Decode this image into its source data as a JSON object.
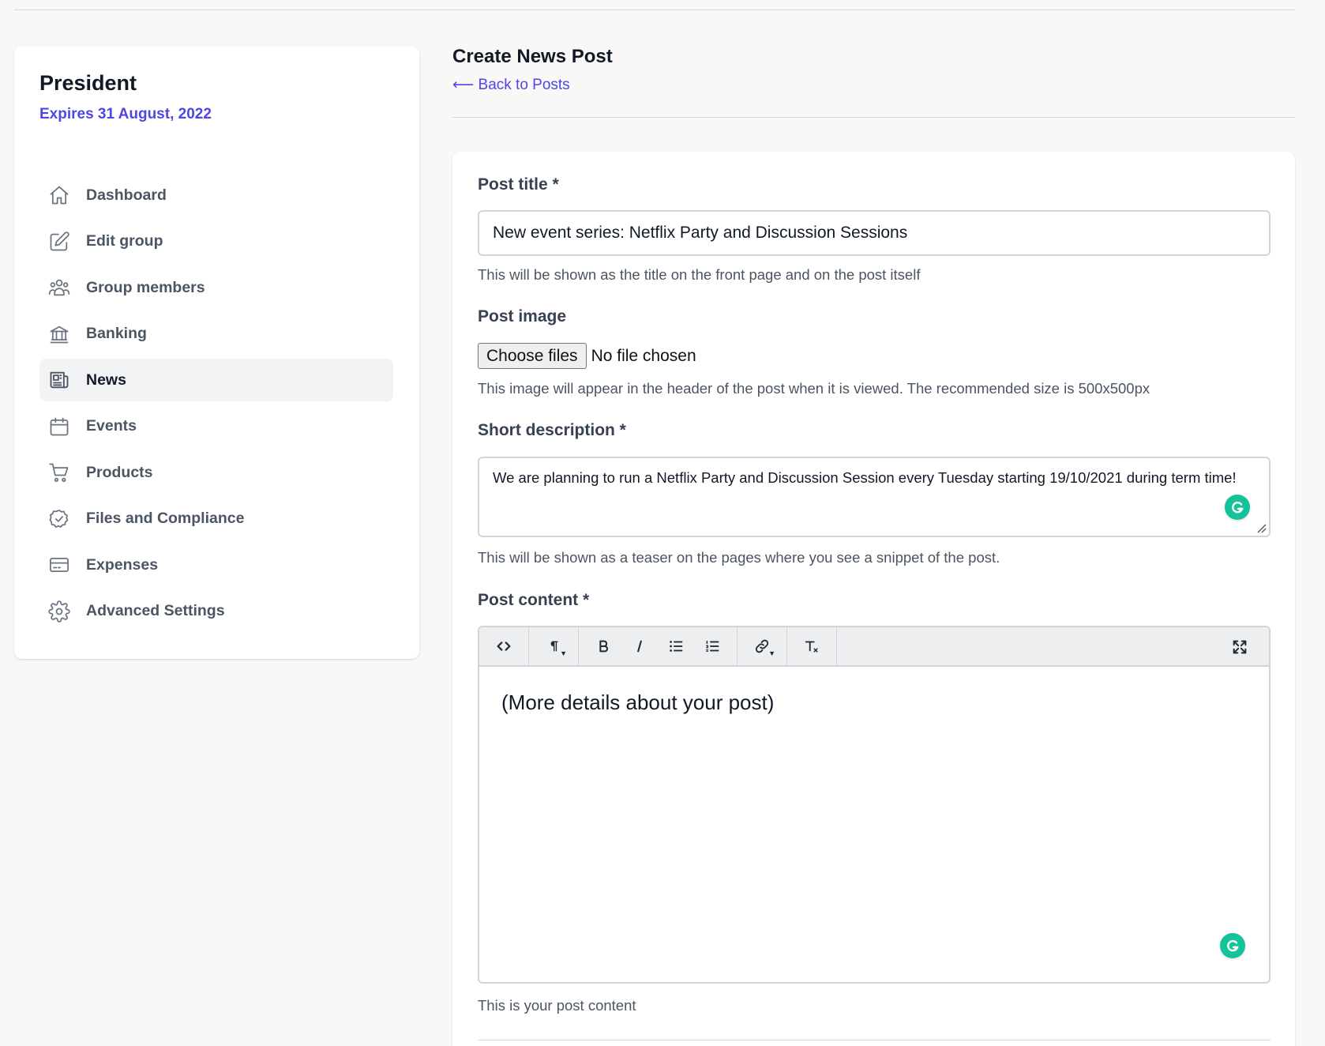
{
  "sidebar": {
    "role_title": "President",
    "role_expiry": "Expires 31 August, 2022",
    "items": [
      {
        "label": "Dashboard",
        "icon": "home-icon"
      },
      {
        "label": "Edit group",
        "icon": "edit-icon"
      },
      {
        "label": "Group members",
        "icon": "users-icon"
      },
      {
        "label": "Banking",
        "icon": "bank-icon"
      },
      {
        "label": "News",
        "icon": "newspaper-icon",
        "active": true
      },
      {
        "label": "Events",
        "icon": "calendar-icon"
      },
      {
        "label": "Products",
        "icon": "cart-icon"
      },
      {
        "label": "Files and Compliance",
        "icon": "badge-check-icon"
      },
      {
        "label": "Expenses",
        "icon": "credit-card-icon"
      },
      {
        "label": "Advanced Settings",
        "icon": "gear-icon"
      }
    ]
  },
  "header": {
    "title": "Create News Post",
    "back_link": "⟵ Back to Posts"
  },
  "form": {
    "post_title": {
      "label": "Post title *",
      "value": "New event series: Netflix Party and Discussion Sessions",
      "help": "This will be shown as the title on the front page and on the post itself"
    },
    "post_image": {
      "label": "Post image",
      "button": "Choose files",
      "status": "No file chosen",
      "help": "This image will appear in the header of the post when it is viewed. The recommended size is 500x500px"
    },
    "short_description": {
      "label": "Short description *",
      "value": "We are planning to run a Netflix Party and Discussion Session every Tuesday starting 19/10/2021 during term time!",
      "help": "This will be shown as a teaser on the pages where you see a snippet of the post."
    },
    "post_content": {
      "label": "Post content *",
      "value": "(More details about your post)",
      "help": "This is your post content"
    }
  },
  "colors": {
    "accent": "#4f46e5",
    "background": "#f9f8f6",
    "grammarly": "#15c39a"
  }
}
